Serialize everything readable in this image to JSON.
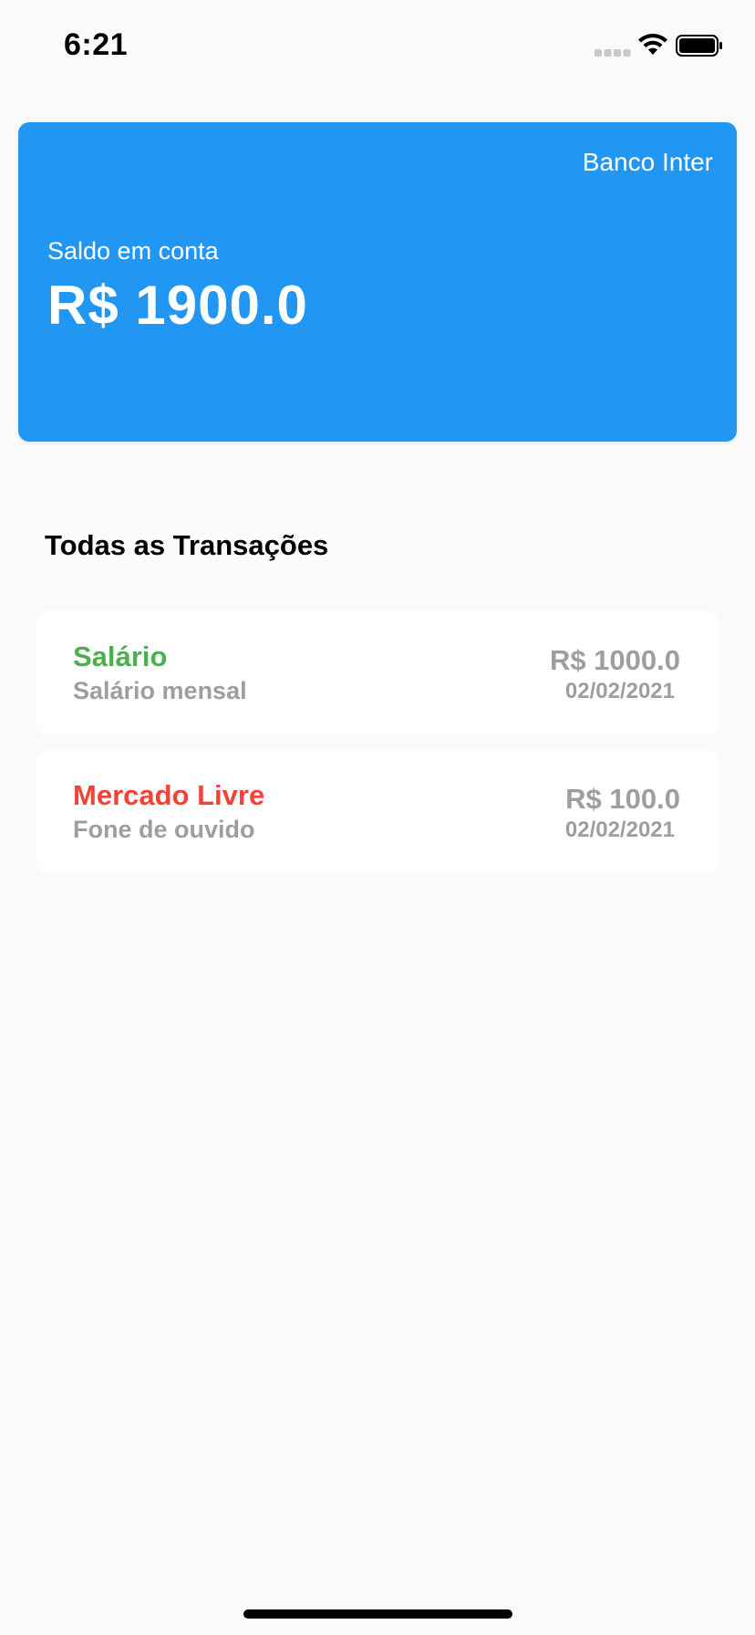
{
  "status_bar": {
    "time": "6:21"
  },
  "balance_card": {
    "bank_name": "Banco Inter",
    "label": "Saldo em conta",
    "value": "R$ 1900.0",
    "color": "#2196f3"
  },
  "transactions_section": {
    "title": "Todas as Transações"
  },
  "transactions": [
    {
      "title": "Salário",
      "description": "Salário mensal",
      "amount": "R$ 1000.0",
      "date": "02/02/2021",
      "color": "#4caf50"
    },
    {
      "title": "Mercado Livre",
      "description": "Fone de ouvido",
      "amount": "R$ 100.0",
      "date": "02/02/2021",
      "color": "#f44336"
    }
  ],
  "icons": {
    "signal": "signal-icon",
    "wifi": "wifi-icon",
    "battery": "battery-icon"
  }
}
